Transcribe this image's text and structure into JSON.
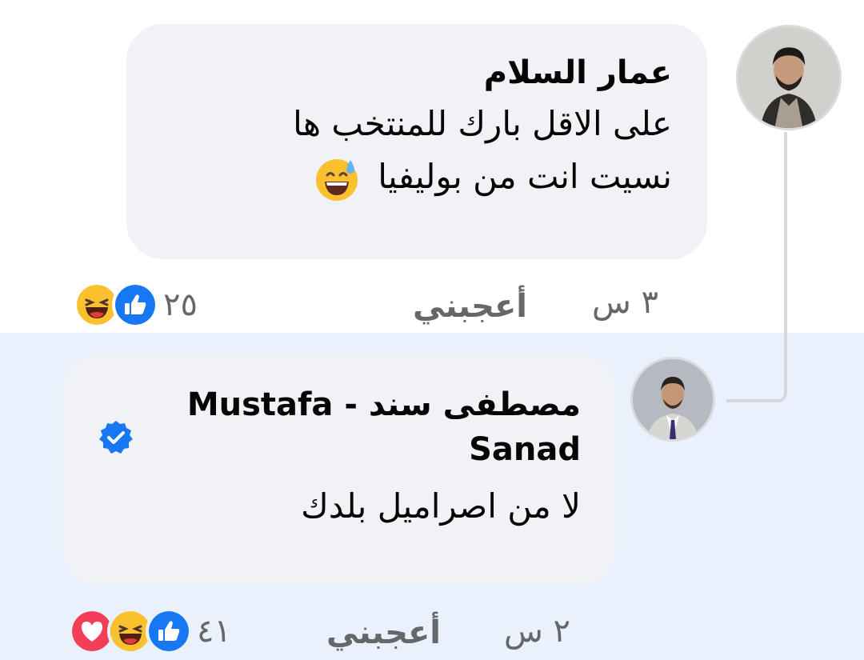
{
  "comments": [
    {
      "author": "عمار السلام",
      "text_line1": "على الاقل بارك للمنتخب ها",
      "text_line2": "نسيت انت من بوليفيا",
      "emoji": "grinning-sweat-emoji",
      "time": "٣ س",
      "like_label": "أعجبني",
      "reaction_count": "٢٥",
      "reactions": [
        "haha",
        "like"
      ]
    },
    {
      "author_line1": "مصطفى سند - Mustafa",
      "author_line2": "Sanad",
      "verified": true,
      "text": "لا من اصراميل بلدك",
      "time": "٢ س",
      "like_label": "أعجبني",
      "reaction_count": "٤١",
      "reactions": [
        "love",
        "haha",
        "like"
      ]
    }
  ],
  "colors": {
    "bubble_bg": "#f0f2f5",
    "highlight_bg": "#e9f2fc",
    "meta_text": "#65676b",
    "like_blue": "#1877f2",
    "love_red": "#f33e58",
    "verified_blue": "#1877f2"
  }
}
